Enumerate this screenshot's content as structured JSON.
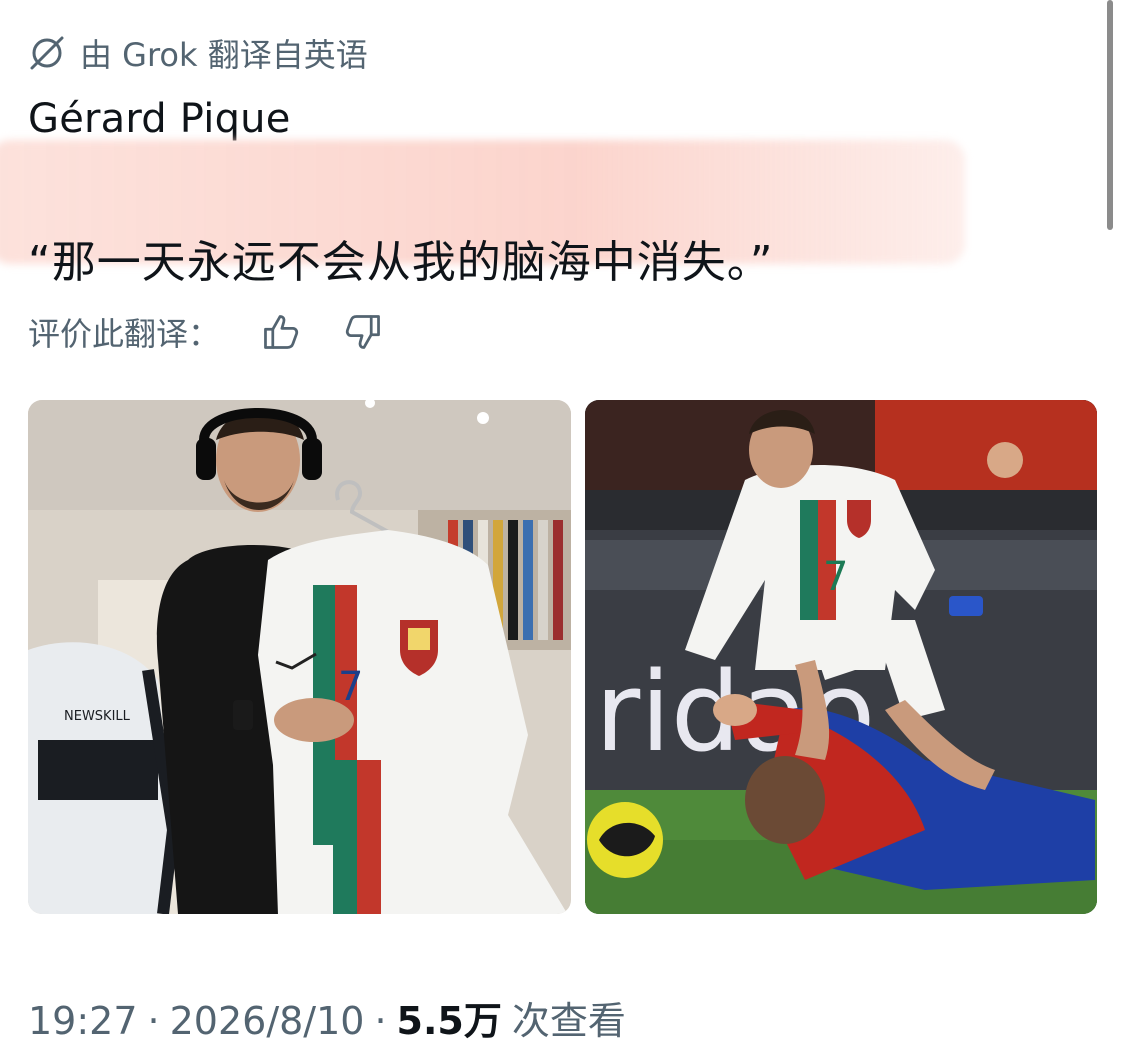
{
  "translation": {
    "icon": "translate-globe-icon",
    "label": "由 Grok 翻译自英语"
  },
  "post": {
    "author_line": "Gérard Pique",
    "quote": "“那一天永远不会从我的脑海中消失。”"
  },
  "rating": {
    "label": "评价此翻译：",
    "thumbs_up_icon": "thumbs-up-icon",
    "thumbs_down_icon": "thumbs-down-icon"
  },
  "media": {
    "left": {
      "description_icon": "photo-pique-holding-portugal-jersey",
      "chair_logo": "NEWSKILL",
      "jersey_number": "7"
    },
    "right": {
      "description_icon": "photo-ronaldo-stepping-over-pique",
      "jersey_number": "7",
      "board_text": "ridao"
    }
  },
  "meta": {
    "time": "19:27",
    "date": "2026/8/10",
    "sep": "·",
    "views_count": "5.5万",
    "views_label": "次查看"
  },
  "colors": {
    "text_primary": "#0f1419",
    "text_secondary": "#536471",
    "highlight": "#fbcdc4"
  }
}
